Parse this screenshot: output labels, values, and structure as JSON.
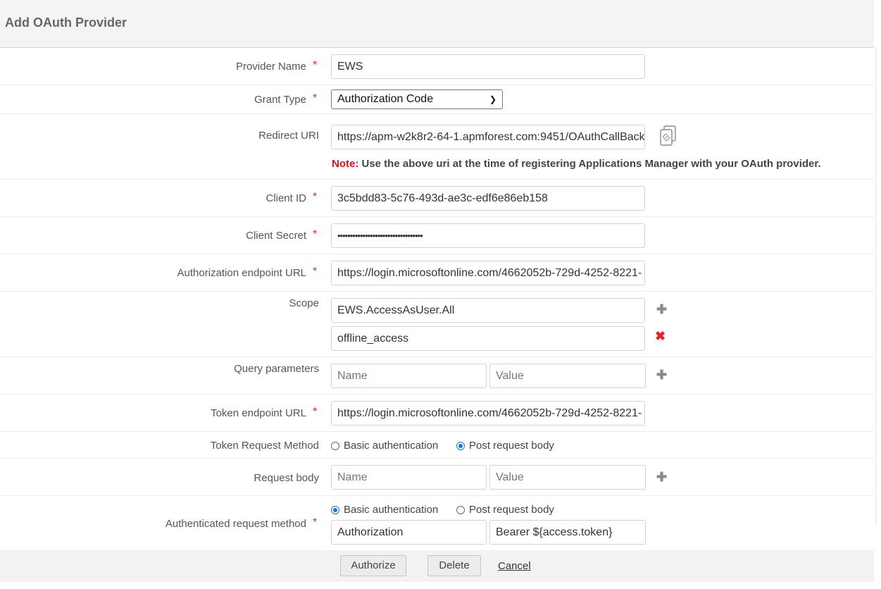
{
  "title": "Add OAuth Provider",
  "fields": {
    "provider_name": {
      "label": "Provider Name",
      "value": "EWS"
    },
    "grant_type": {
      "label": "Grant Type",
      "value": "Authorization Code"
    },
    "redirect_uri": {
      "label": "Redirect URI",
      "value": "https://apm-w2k8r2-64-1.apmforest.com:9451/OAuthCallBack"
    },
    "note": {
      "prefix": "Note:",
      "text": " Use the above uri at the time of registering Applications Manager with your OAuth provider."
    },
    "client_id": {
      "label": "Client ID",
      "value": "3c5bdd83-5c76-493d-ae3c-edf6e86eb158"
    },
    "client_secret": {
      "label": "Client Secret",
      "value": "••••••••••••••••••••••••••••••••••"
    },
    "auth_endpoint": {
      "label": "Authorization endpoint URL",
      "value": "https://login.microsoftonline.com/4662052b-729d-4252-8221-"
    },
    "scope": {
      "label": "Scope",
      "values": [
        "EWS.AccessAsUser.All",
        "offline_access"
      ]
    },
    "query_params": {
      "label": "Query parameters",
      "name_placeholder": "Name",
      "value_placeholder": "Value"
    },
    "token_endpoint": {
      "label": "Token endpoint URL",
      "value": "https://login.microsoftonline.com/4662052b-729d-4252-8221-"
    },
    "token_request_method": {
      "label": "Token Request Method",
      "options": [
        "Basic authentication",
        "Post request body"
      ],
      "selected": "Post request body"
    },
    "request_body": {
      "label": "Request body",
      "name_placeholder": "Name",
      "value_placeholder": "Value"
    },
    "authenticated_request_method": {
      "label": "Authenticated request method",
      "options": [
        "Basic authentication",
        "Post request body"
      ],
      "selected": "Basic authentication",
      "header_name": "Authorization",
      "header_value": "Bearer ${access.token}"
    }
  },
  "required_mark": "*",
  "icons": {
    "add": "plus-icon",
    "remove": "x-icon",
    "copy": "copy-link-icon",
    "dropdown": "chevron-down-icon"
  },
  "buttons": {
    "authorize": "Authorize",
    "delete": "Delete",
    "cancel": "Cancel"
  },
  "colors": {
    "required": "#e0282e",
    "note": "#e0101a",
    "radio_selected": "#1a73e8"
  }
}
